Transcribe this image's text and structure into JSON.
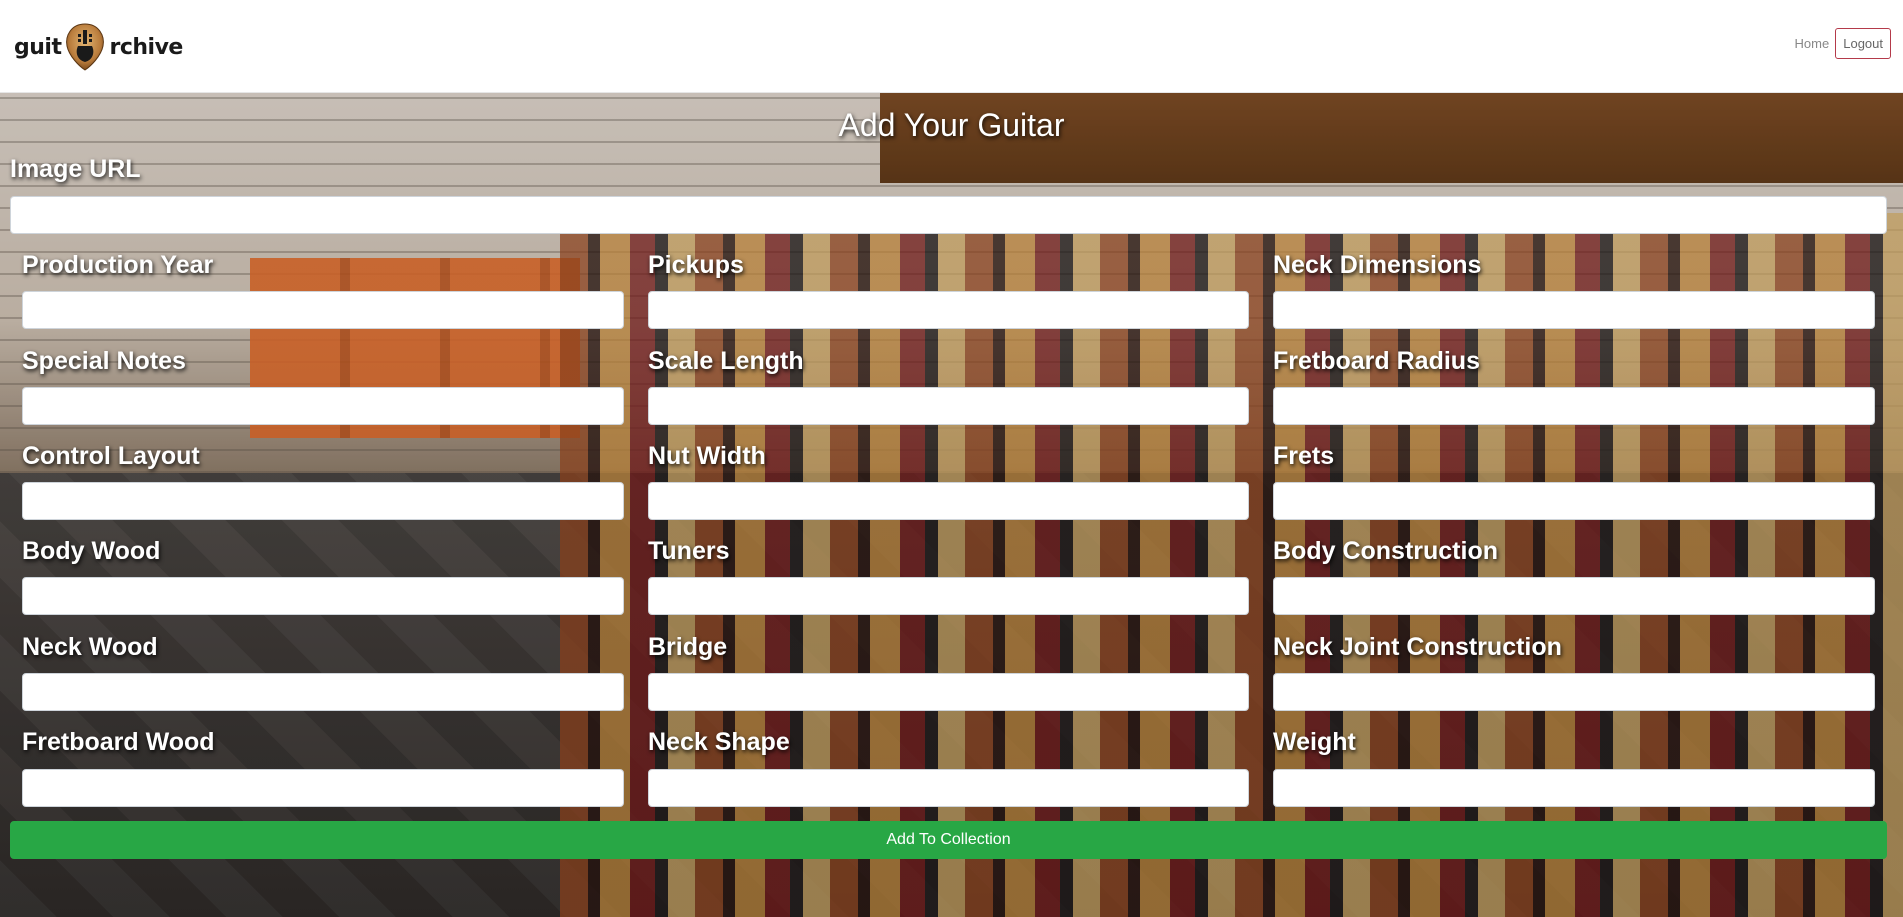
{
  "header": {
    "logo_part1": "guit",
    "logo_part2": "rchive",
    "nav": {
      "home": "Home",
      "logout": "Logout"
    }
  },
  "form": {
    "title": "Add Your Guitar",
    "image_url_label": "Image URL",
    "col1": {
      "production_year": "Production Year",
      "special_notes": "Special Notes",
      "control_layout": "Control Layout",
      "body_wood": "Body Wood",
      "neck_wood": "Neck Wood",
      "fretboard_wood": "Fretboard Wood"
    },
    "col2": {
      "pickups": "Pickups",
      "scale_length": "Scale Length",
      "nut_width": "Nut Width",
      "tuners": "Tuners",
      "bridge": "Bridge",
      "neck_shape": "Neck Shape"
    },
    "col3": {
      "neck_dimensions": "Neck Dimensions",
      "fretboard_radius": "Fretboard Radius",
      "frets": "Frets",
      "body_construction": "Body Construction",
      "neck_joint_construction": "Neck Joint Construction",
      "weight": "Weight"
    },
    "submit_label": "Add To Collection"
  },
  "colors": {
    "submit": "#28a745",
    "logout_border": "#b43a4a"
  },
  "icons": {
    "logo": "guitar-pick-icon"
  }
}
